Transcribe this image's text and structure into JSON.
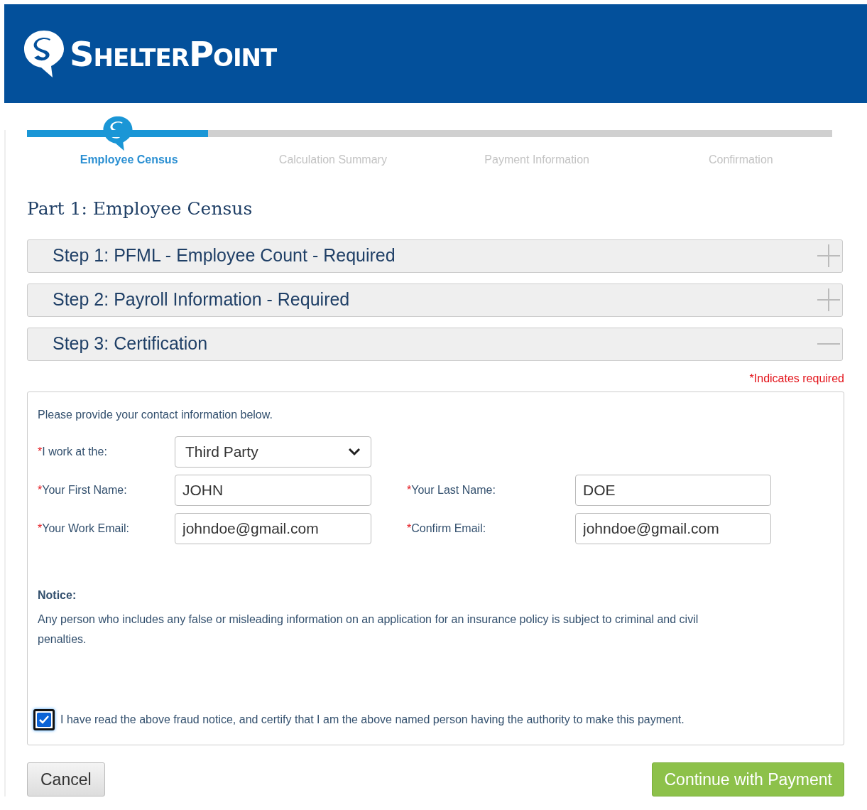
{
  "header": {
    "logo_text": "ShelterPoint"
  },
  "progress": {
    "level": 0.225,
    "steps": [
      {
        "label": "Employee Census",
        "selected": true
      },
      {
        "label": "Calculation Summary",
        "selected": false
      },
      {
        "label": "Payment Information",
        "selected": false
      },
      {
        "label": "Confirmation",
        "selected": false
      }
    ]
  },
  "title": "Part 1: Employee Census",
  "sections": [
    {
      "title": "Step 1: PFML - Employee Count - Required",
      "expanded": false
    },
    {
      "title": "Step 2: Payroll Information - Required",
      "expanded": false
    },
    {
      "title": "Step 3: Certification",
      "expanded": true
    }
  ],
  "required_note": "*Indicates required",
  "form": {
    "intro": "Please provide your contact information below.",
    "fields": [
      {
        "kind": "select",
        "mark": "*",
        "label": "I work at the:",
        "value": "Third Party"
      },
      {
        "kind": "text",
        "mark": "*",
        "label": "Your First Name:",
        "value": "JOHN"
      },
      {
        "kind": "text",
        "mark": "*",
        "label": "Your Last Name:",
        "value": "DOE"
      },
      {
        "kind": "text",
        "mark": "*",
        "label": "Your Work Email:",
        "value": "johndoe@gmail.com"
      },
      {
        "kind": "text",
        "mark": "*",
        "label": "Confirm Email:",
        "value": "johndoe@gmail.com"
      }
    ],
    "notice_title": "Notice:",
    "notice_text": "Any person who includes any false or misleading information on an application for an insurance policy is subject to criminal and civil penalties.",
    "certify": {
      "label": "I have read the above fraud notice, and certify that I am the above named person having the authority to make this payment.",
      "checked": true
    }
  },
  "buttons": {
    "cancel": "Cancel",
    "continue": "Continue with Payment"
  }
}
